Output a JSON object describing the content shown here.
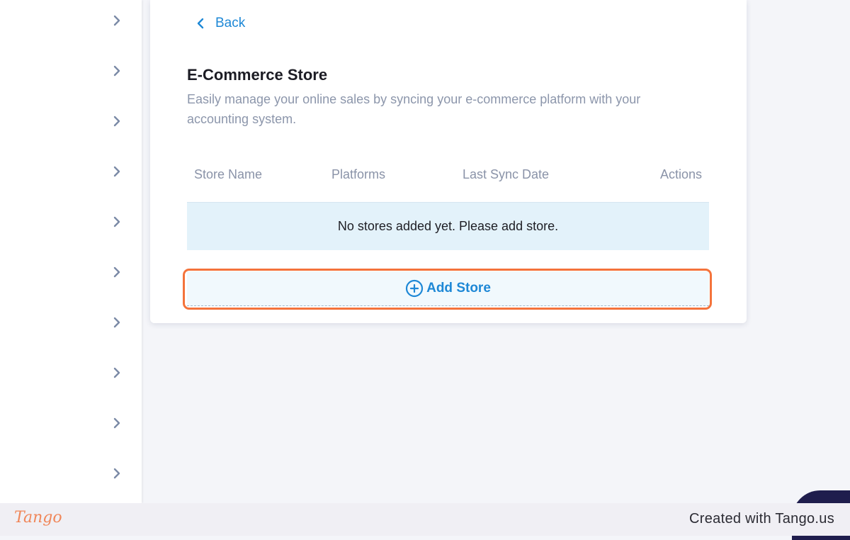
{
  "sidebar": {
    "items": [
      {
        "icon": "chevron-right-icon"
      },
      {
        "icon": "chevron-right-icon"
      },
      {
        "icon": "chevron-right-icon"
      },
      {
        "icon": "chevron-right-icon"
      },
      {
        "icon": "chevron-right-icon"
      },
      {
        "icon": "chevron-right-icon"
      },
      {
        "icon": "chevron-right-icon"
      },
      {
        "icon": "chevron-right-icon"
      },
      {
        "icon": "chevron-right-icon"
      },
      {
        "icon": "chevron-right-icon"
      }
    ]
  },
  "header": {
    "back_label": "Back",
    "back_icon": "chevron-left-icon"
  },
  "main": {
    "title": "E-Commerce Store",
    "description": "Easily manage your online sales by syncing your e-commerce platform with your accounting system.",
    "table": {
      "columns": [
        "Store Name",
        "Platforms",
        "Last Sync Date",
        "Actions"
      ],
      "empty_message": "No stores added yet. Please add store."
    },
    "add_store_label": "Add Store",
    "add_store_icon": "plus-circle-icon"
  },
  "footer": {
    "logo_text": "Tango",
    "credit": "Created with Tango.us"
  },
  "colors": {
    "accent": "#1e88d6",
    "highlight": "#f4733b",
    "empty_row_bg": "#e3f2fa",
    "muted_text": "#8c96ab",
    "chat_bubble": "#1f1d4d"
  }
}
